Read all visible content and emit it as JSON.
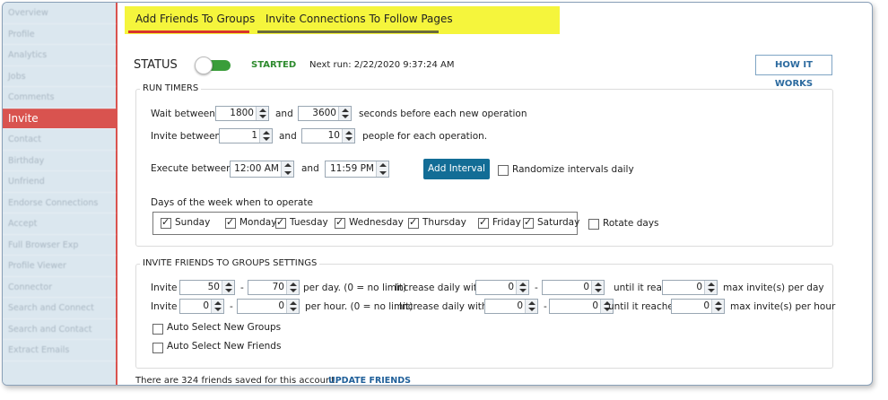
{
  "sidebar": {
    "items": [
      {
        "label": "Overview"
      },
      {
        "label": "Profile"
      },
      {
        "label": "Analytics"
      },
      {
        "label": "Jobs"
      },
      {
        "label": "Comments"
      },
      {
        "label": "Invite"
      },
      {
        "label": "Contact"
      },
      {
        "label": "Birthday"
      },
      {
        "label": "Unfriend"
      },
      {
        "label": "Endorse Connections"
      },
      {
        "label": "Accept"
      },
      {
        "label": "Full Browser Exp"
      },
      {
        "label": "Profile Viewer"
      },
      {
        "label": "Connector"
      },
      {
        "label": "Search and Connect"
      },
      {
        "label": "Search and Contact"
      },
      {
        "label": "Extract Emails"
      }
    ],
    "active_index": 5,
    "accent_color": "#d9534f"
  },
  "tabs": {
    "tab1": "Add Friends To Groups",
    "tab2": "Invite Connections To Follow Pages",
    "highlight_color": "#f5f53c"
  },
  "status": {
    "label": "STATUS",
    "state": "STARTED",
    "next_run": "Next run: 2/22/2020 9:37:24 AM",
    "how_button": "HOW IT WORKS",
    "toggle_on": true
  },
  "run_timers": {
    "legend": "RUN TIMERS",
    "wait_label": "Wait between",
    "wait_min": "1800",
    "and1": "and",
    "wait_max": "3600",
    "wait_suffix": "seconds before each new operation",
    "invite_label": "Invite between",
    "invite_min": "1",
    "and2": "and",
    "invite_max": "10",
    "invite_suffix": "people for each operation.",
    "execute_label": "Execute between",
    "exec_start": "12:00 AM",
    "and3": "and",
    "exec_end": "11:59 PM",
    "add_interval": "Add Interval",
    "randomize": "Randomize intervals daily",
    "days_label": "Days of the week when to operate",
    "days": [
      {
        "label": "Sunday",
        "checked": true
      },
      {
        "label": "Monday",
        "checked": true
      },
      {
        "label": "Tuesday",
        "checked": true
      },
      {
        "label": "Wednesday",
        "checked": true
      },
      {
        "label": "Thursday",
        "checked": true
      },
      {
        "label": "Friday",
        "checked": true
      },
      {
        "label": "Saturday",
        "checked": true
      }
    ],
    "rotate_days": "Rotate days"
  },
  "settings": {
    "legend": "INVITE FRIENDS TO GROUPS SETTINGS",
    "row1": {
      "invite": "Invite",
      "min": "50",
      "dash": "-",
      "max": "70",
      "per": "per day. (0 = no limit)",
      "increase": "Increase daily with",
      "inc_min": "0",
      "dash2": "-",
      "inc_max": "0",
      "until": "until it reaches",
      "limit": "0",
      "suffix": "max invite(s) per day"
    },
    "row2": {
      "invite": "Invite",
      "min": "0",
      "dash": "-",
      "max": "0",
      "per": "per hour. (0 = no limit)",
      "increase": "Increase daily with",
      "inc_min": "0",
      "dash2": "-",
      "inc_max": "0",
      "until": "until it reaches",
      "limit": "0",
      "suffix": "max invite(s) per hour"
    },
    "auto_groups": "Auto Select New Groups",
    "auto_friends": "Auto Select New Friends"
  },
  "footer": {
    "friends_text": "There are 324 friends saved for this account.",
    "update_link": "UPDATE FRIENDS"
  }
}
